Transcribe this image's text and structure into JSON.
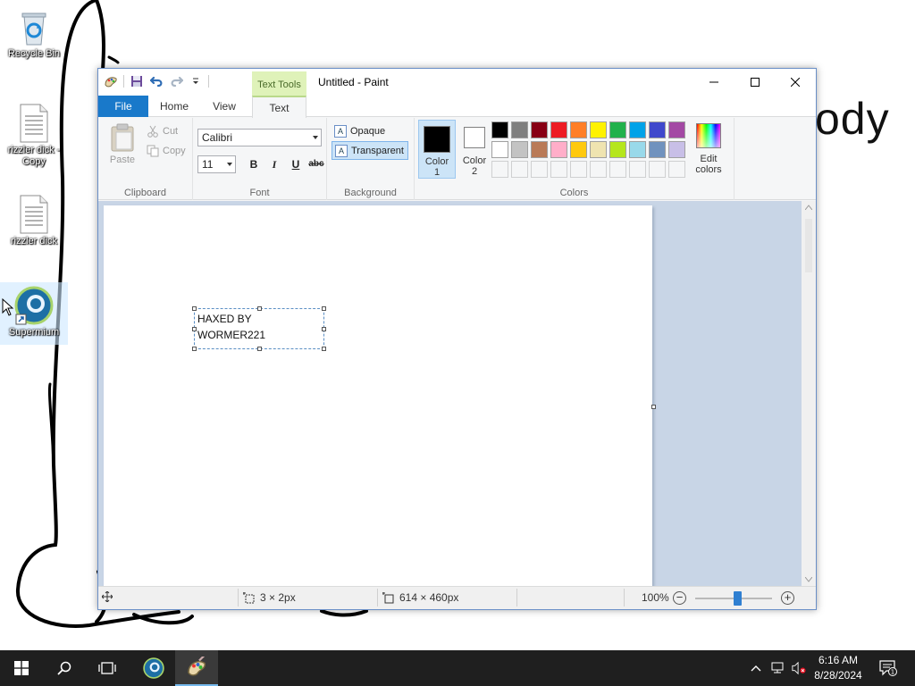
{
  "desktop": {
    "background_text": "ody",
    "icons": [
      {
        "label": "Recycle Bin",
        "icon": "recycle-bin-icon"
      },
      {
        "label": "rizzler dick - Copy",
        "icon": "text-file-icon"
      },
      {
        "label": "rizzler dick",
        "icon": "text-file-icon"
      },
      {
        "label": "Supermium",
        "icon": "supermium-browser-icon"
      }
    ]
  },
  "paint": {
    "title": "Untitled - Paint",
    "context_tab_group": "Text Tools",
    "tabs": {
      "file": "File",
      "home": "Home",
      "view": "View",
      "text": "Text"
    },
    "clipboard": {
      "paste": "Paste",
      "cut": "Cut",
      "copy": "Copy",
      "label": "Clipboard"
    },
    "font": {
      "family": "Calibri",
      "size": "11",
      "bold": "B",
      "italic": "I",
      "underline": "U",
      "strike": "abc",
      "label": "Font"
    },
    "background": {
      "opaque": "Opaque",
      "transparent": "Transparent",
      "label": "Background",
      "selected": "Transparent"
    },
    "colors": {
      "color1_label": "Color\n1",
      "color2_label": "Color\n2",
      "color1": "#000000",
      "color2": "#ffffff",
      "palette": [
        "#000000",
        "#7f7f7f",
        "#880015",
        "#ed1c24",
        "#ff7f27",
        "#fff200",
        "#22b14c",
        "#00a2e8",
        "#3f48cc",
        "#a349a4",
        "#ffffff",
        "#c3c3c3",
        "#b97a57",
        "#ffaec9",
        "#ffc90e",
        "#efe4b0",
        "#b5e61d",
        "#99d9ea",
        "#7092be",
        "#c8bfe7"
      ],
      "edit_colors": "Edit\ncolors",
      "label": "Colors"
    },
    "canvas_text": {
      "line1": "HAXED BY",
      "line2": "WORMER221"
    },
    "status": {
      "selection_size": "3 × 2px",
      "image_size": "614 × 460px",
      "zoom": "100%",
      "zoom_level": 0.55
    }
  },
  "taskbar": {
    "clock_time": "6:16 AM",
    "clock_date": "8/28/2024",
    "notification_count": "1"
  },
  "colors": {
    "accent": "#1979ca",
    "context_tab": "#dff2b9",
    "taskbar": "#1f1f1f"
  }
}
